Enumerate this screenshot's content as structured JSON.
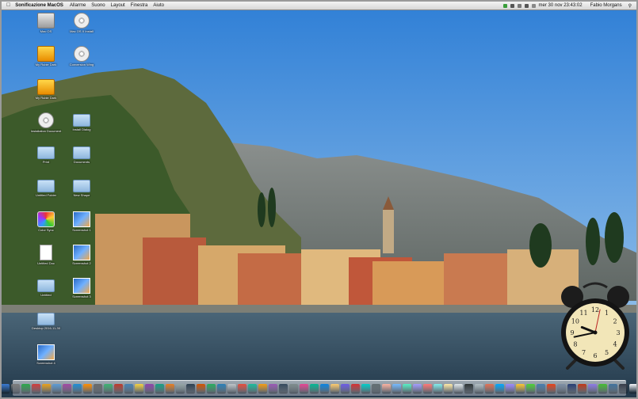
{
  "menubar": {
    "apple": "",
    "app_name": "Sonificazione MacOS",
    "menus": [
      "Allarme",
      "Suono",
      "Layout",
      "Finestra",
      "Aiuto"
    ],
    "datetime": "mer 30 nov  23:43:02",
    "user": "Fabio Morgans"
  },
  "desktop_icons": [
    {
      "label": "Mac OS",
      "kind": "drive"
    },
    {
      "label": "Mac OS X Install",
      "kind": "disc"
    },
    {
      "label": "My Ruble Dark",
      "kind": "box"
    },
    {
      "label": "Conversion Wing",
      "kind": "disc"
    },
    {
      "label": "My Ruble Dark",
      "kind": "box"
    },
    {
      "label": "Installation Document",
      "kind": "disc"
    },
    {
      "label": "Install Dialog",
      "kind": "folder"
    },
    {
      "label": "Print",
      "kind": "folder"
    },
    {
      "label": "Documents",
      "kind": "folder"
    },
    {
      "label": "Untitled Folder",
      "kind": "folder"
    },
    {
      "label": "Color Sync",
      "kind": "color"
    },
    {
      "label": "New Shape",
      "kind": "folder"
    },
    {
      "label": "Untitled Doc",
      "kind": "doc"
    },
    {
      "label": "Screenshot 1",
      "kind": "img"
    },
    {
      "label": "Untitled",
      "kind": "folder"
    },
    {
      "label": "Screenshot 2",
      "kind": "img"
    },
    {
      "label": "Desktop 2016-11-30",
      "kind": "folder"
    },
    {
      "label": "Screenshot 3",
      "kind": "img"
    },
    {
      "label": "Screenshot 4",
      "kind": "img"
    }
  ],
  "clock": {
    "hours": 9,
    "minutes": 43,
    "seconds": 2
  },
  "dock": {
    "colors": [
      "#3a7bd5",
      "#7d7d7d",
      "#2aa84a",
      "#d23b3b",
      "#e9a019",
      "#5b9bd5",
      "#a349a4",
      "#1f8dd6",
      "#ff8c00",
      "#6a6a6a",
      "#3cb371",
      "#c0392b",
      "#4682b4",
      "#f4d03f",
      "#8e44ad",
      "#16a085",
      "#e67e22",
      "#95a5a6",
      "#2c3e50",
      "#d35400",
      "#27ae60",
      "#2980b9",
      "#bdc3c7",
      "#e74c3c",
      "#1abc9c",
      "#f39c12",
      "#9b59b6",
      "#34495e",
      "#7f8c8d",
      "#e84393",
      "#00b894",
      "#0984e3",
      "#fdcb6e",
      "#6c5ce7",
      "#d63031",
      "#00cec9",
      "#636e72",
      "#fab1a0",
      "#74b9ff",
      "#55efc4",
      "#a29bfe",
      "#ff7675",
      "#81ecec",
      "#ffeaa7",
      "#dfe6e9",
      "#2d3436",
      "#b2bec3",
      "#e17055",
      "#00a8ff",
      "#9c88ff",
      "#fbc531",
      "#4cd137",
      "#487eb0",
      "#e84118",
      "#7f8fa6",
      "#273c75",
      "#c23616",
      "#8c7ae6",
      "#44bd32",
      "#40739e",
      "#353b48",
      "#f5f6fa"
    ]
  },
  "colors": {
    "sky_top": "#2f7fd6",
    "sky_bottom": "#a6cdee",
    "water": "#35546a"
  }
}
